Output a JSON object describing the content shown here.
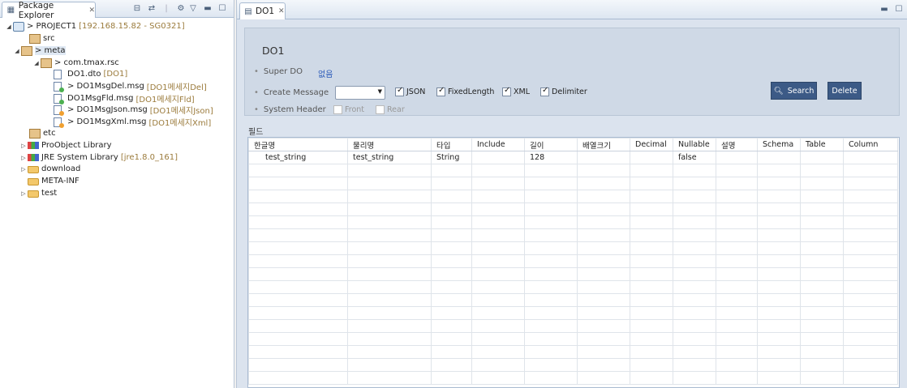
{
  "left": {
    "tab_label": "Package Explorer",
    "tree": [
      {
        "label": "> PROJECT1",
        "deco": "[192.168.15.82 - SG0321]"
      },
      {
        "label": "src",
        "deco": ""
      },
      {
        "label": "> meta",
        "deco": ""
      },
      {
        "label": "> com.tmax.rsc",
        "deco": ""
      },
      {
        "label": "DO1.dto",
        "deco": "[DO1]"
      },
      {
        "label": "> DO1MsgDel.msg",
        "deco": "[DO1메세지Del]"
      },
      {
        "label": "DO1MsgFld.msg",
        "deco": "[DO1메세지Fld]"
      },
      {
        "label": "> DO1MsgJson.msg",
        "deco": "[DO1메세지Json]"
      },
      {
        "label": "> DO1MsgXml.msg",
        "deco": "[DO1메세지Xml]"
      },
      {
        "label": "etc",
        "deco": ""
      },
      {
        "label": "ProObject Library",
        "deco": ""
      },
      {
        "label": "JRE System Library",
        "deco": "[jre1.8.0_161]"
      },
      {
        "label": "download",
        "deco": ""
      },
      {
        "label": "META-INF",
        "deco": ""
      },
      {
        "label": "test",
        "deco": ""
      }
    ]
  },
  "editor": {
    "tab_label": "DO1",
    "title": "DO1",
    "super_do_label": "Super DO",
    "super_do_value": "없음",
    "create_message_label": "Create Message",
    "formats": [
      "JSON",
      "FixedLength",
      "XML",
      "Delimiter"
    ],
    "system_header_label": "System Header",
    "system_header_options": [
      "Front",
      "Rear"
    ],
    "search_label": "Search",
    "delete_label": "Delete",
    "field_section_label": "필드",
    "columns": [
      "한글명",
      "물리명",
      "타입",
      "Include",
      "길이",
      "배열크기",
      "Decimal",
      "Nullable",
      "설명",
      "Schema",
      "Table",
      "Column"
    ],
    "rows": [
      [
        "test_string",
        "test_string",
        "String",
        "",
        "128",
        "",
        "",
        "false",
        "",
        "",
        "",
        ""
      ]
    ]
  }
}
